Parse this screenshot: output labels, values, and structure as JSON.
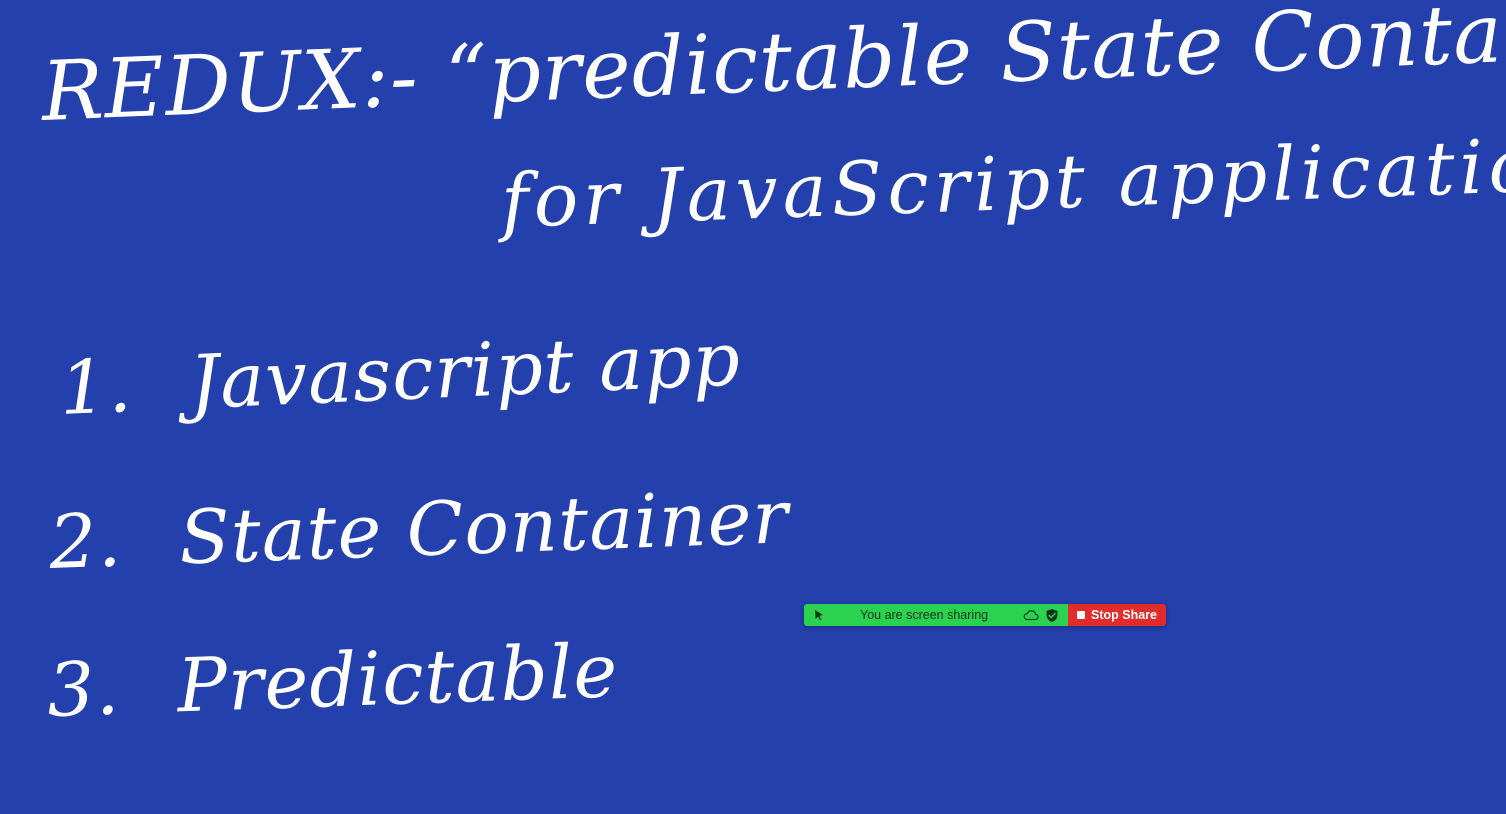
{
  "whiteboard": {
    "background_color": "#2440ad",
    "ink_color": "#ffffff",
    "title_line_1": "REDUX:- “predictable State Container",
    "title_line_2": "for JavaScript application”",
    "list_items": [
      {
        "number": "1.",
        "text": "Javascript app"
      },
      {
        "number": "2.",
        "text": "State Container"
      },
      {
        "number": "3.",
        "text": "Predictable"
      }
    ]
  },
  "share_toolbar": {
    "status_text": "You are screen sharing",
    "stop_button_label": "Stop Share",
    "status_color": "#2bd24f",
    "stop_color": "#e22b2b",
    "icons": [
      "drag-handle-icon",
      "cloud-icon",
      "shield-check-icon",
      "stop-square-icon"
    ]
  }
}
